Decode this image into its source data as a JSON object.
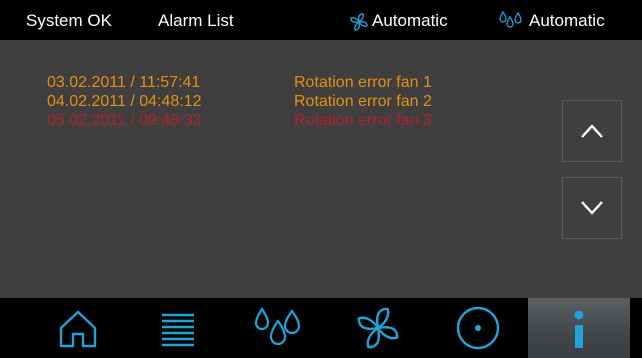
{
  "header": {
    "status": "System OK",
    "title": "Alarm List",
    "fan_mode": "Automatic",
    "humidity_mode": "Automatic"
  },
  "alarms": [
    {
      "timestamp": "03.02.2011 / 11:57:41",
      "message": "Rotation error fan 1",
      "color": "#e58f12"
    },
    {
      "timestamp": "04.02.2011 / 04:48:12",
      "message": "Rotation error fan 2",
      "color": "#e58f12"
    },
    {
      "timestamp": "05.02.2011 / 09:48:33",
      "message": "Rotation error fan 3",
      "color": "#b0212b"
    }
  ],
  "scroll": {
    "up_icon": "chevron-up-icon",
    "down_icon": "chevron-down-icon"
  },
  "nav": [
    {
      "name": "home",
      "icon": "home-icon"
    },
    {
      "name": "list",
      "icon": "list-icon"
    },
    {
      "name": "humidity",
      "icon": "drops-icon"
    },
    {
      "name": "fan",
      "icon": "fan-icon"
    },
    {
      "name": "setpoint",
      "icon": "circle-dot-icon"
    },
    {
      "name": "info",
      "icon": "info-icon",
      "active": true
    }
  ],
  "colors": {
    "background": "#3f3f3f",
    "bar": "#000000",
    "accent_blue": "#1fa3d9",
    "warning": "#e58f12",
    "alarm": "#b0212b"
  }
}
